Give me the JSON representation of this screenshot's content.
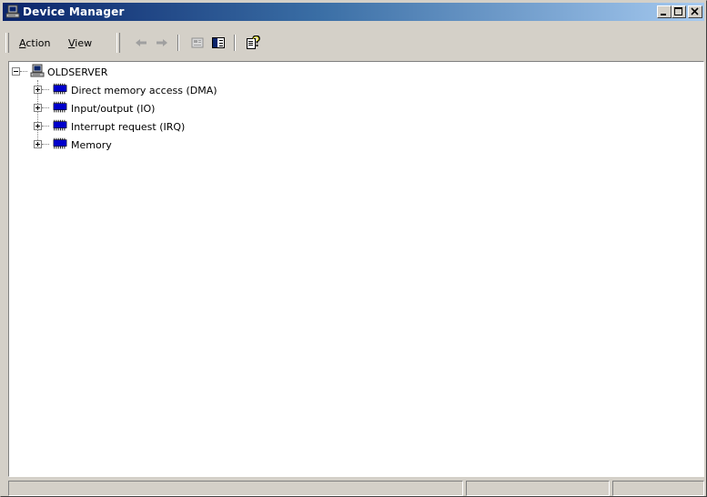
{
  "window": {
    "title": "Device Manager",
    "icon": "computer-icon",
    "controls": [
      "minimize",
      "maximize",
      "close"
    ]
  },
  "menu": {
    "items": [
      {
        "label": "Action",
        "accel": "A",
        "rest": "ction"
      },
      {
        "label": "View",
        "accel": "V",
        "rest": "iew"
      }
    ]
  },
  "toolbar": {
    "buttons": [
      "back-arrow-icon",
      "forward-arrow-icon",
      "properties-icon",
      "show-hide-tree-icon",
      "help-icon"
    ]
  },
  "tree": {
    "root": {
      "label": "OLDSERVER",
      "icon": "computer-icon",
      "expanded": true
    },
    "children": [
      {
        "label": "Direct memory access (DMA)",
        "icon": "chip-icon",
        "expanded": false
      },
      {
        "label": "Input/output (IO)",
        "icon": "chip-icon",
        "expanded": false
      },
      {
        "label": "Interrupt request (IRQ)",
        "icon": "chip-icon",
        "expanded": false
      },
      {
        "label": "Memory",
        "icon": "chip-icon",
        "expanded": false
      }
    ]
  },
  "statusbar": {
    "panels": [
      "",
      "",
      ""
    ]
  },
  "colors": {
    "title_start": "#0a246a",
    "title_end": "#a6caf0",
    "face": "#d4d0c8",
    "chip": "#0000cc"
  }
}
